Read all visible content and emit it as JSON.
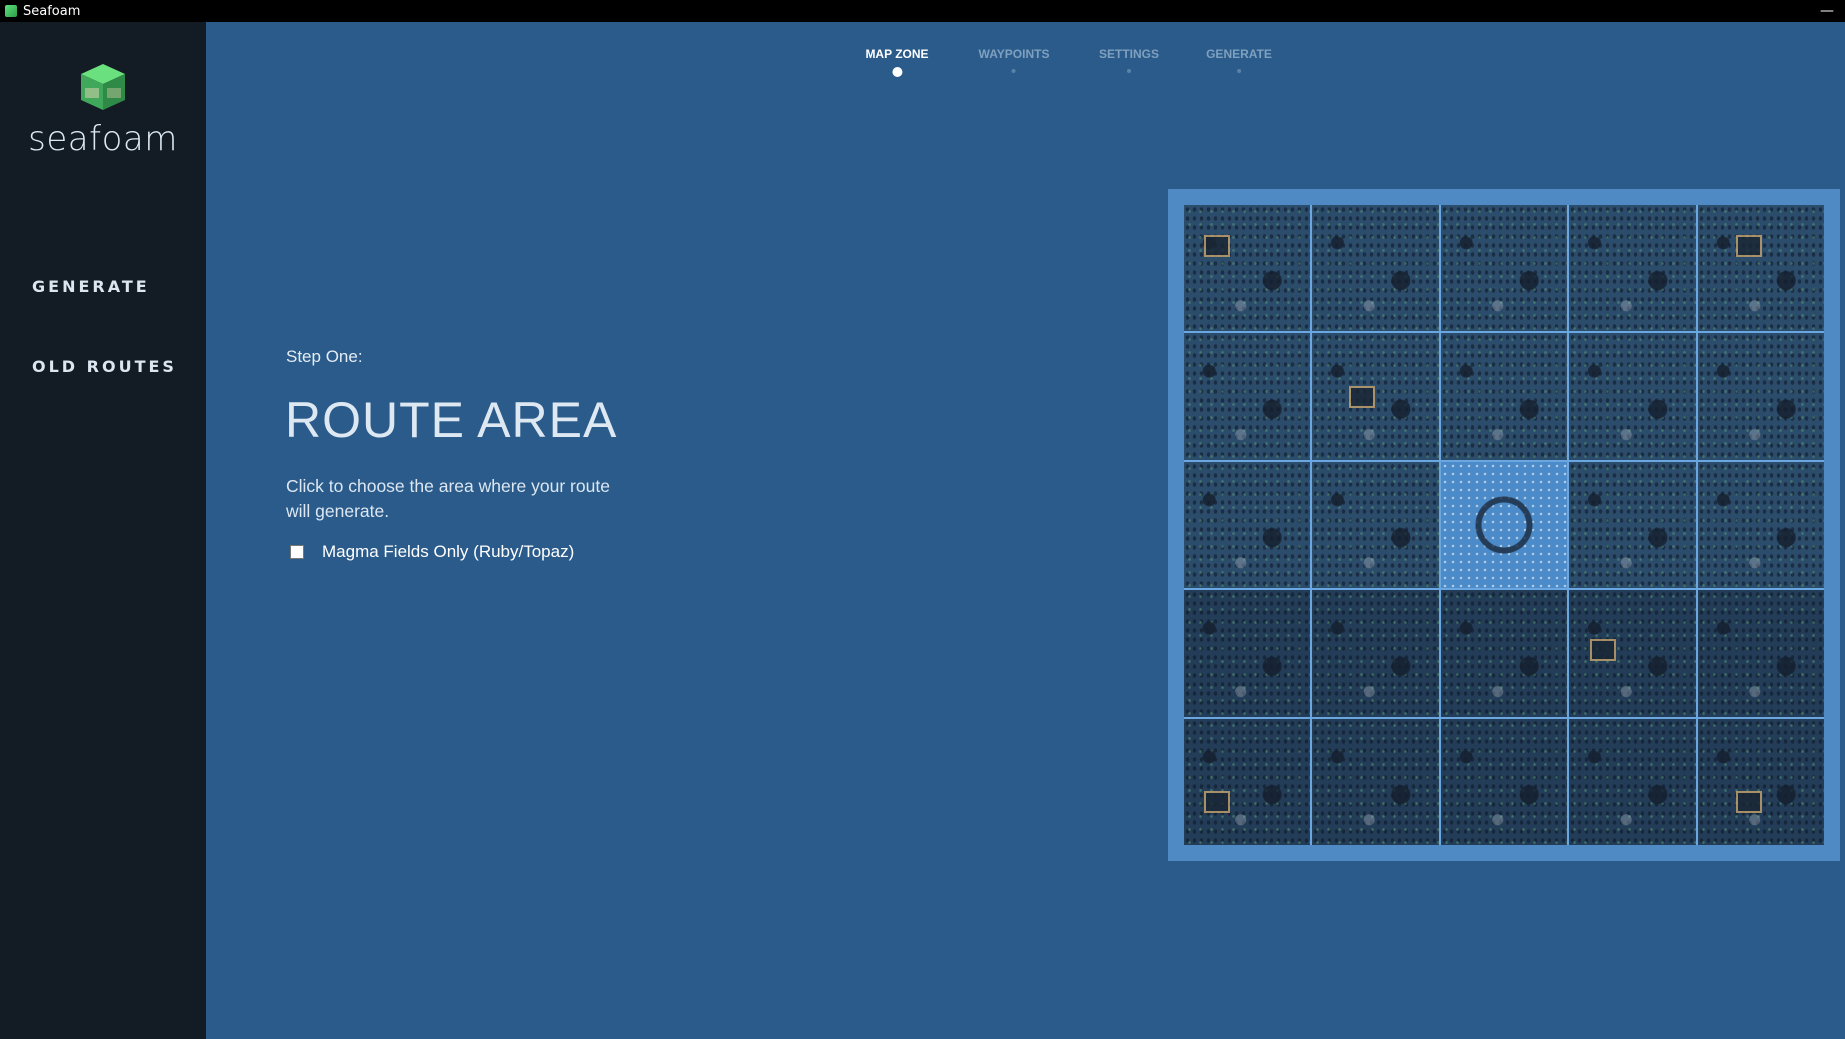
{
  "window": {
    "title": "Seafoam",
    "minimize_label": "—"
  },
  "sidebar": {
    "brand": "seafoam",
    "items": [
      {
        "label": "GENERATE"
      },
      {
        "label": "OLD ROUTES"
      }
    ]
  },
  "steps": [
    {
      "label": "MAP ZONE",
      "active": true
    },
    {
      "label": "WAYPOINTS",
      "active": false
    },
    {
      "label": "SETTINGS",
      "active": false
    },
    {
      "label": "GENERATE",
      "active": false
    }
  ],
  "content": {
    "step_label": "Step One:",
    "title": "ROUTE AREA",
    "description": "Click to choose the area where your route will generate.",
    "checkbox_label": "Magma Fields Only (Ruby/Topaz)",
    "checkbox_checked": false
  },
  "map": {
    "rows": 5,
    "cols": 5,
    "selected_cell": {
      "row": 2,
      "col": 2
    }
  },
  "colors": {
    "background": "#2a5b8a",
    "sidebar": "#131b24",
    "map_frame": "#4f8ac4",
    "selected_cell": "#4c8bc9"
  }
}
